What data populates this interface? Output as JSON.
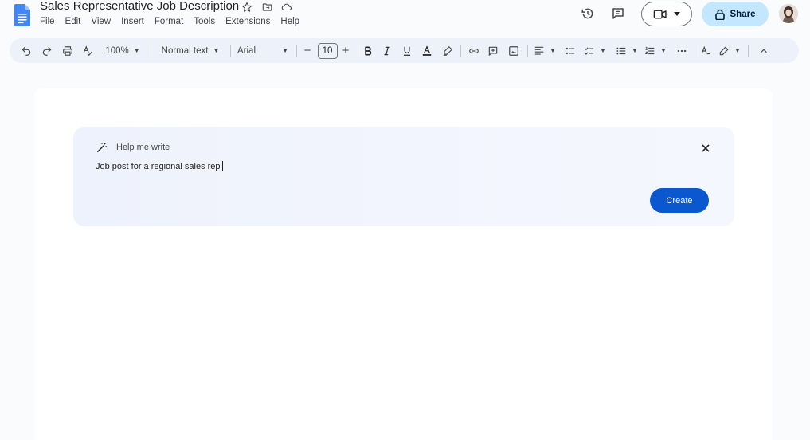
{
  "document": {
    "title": "Sales Representative Job Description"
  },
  "menu": [
    "File",
    "Edit",
    "View",
    "Insert",
    "Format",
    "Tools",
    "Extensions",
    "Help"
  ],
  "share": {
    "label": "Share"
  },
  "toolbar": {
    "zoom": "100%",
    "style": "Normal text",
    "font": "Arial",
    "font_size": "10",
    "minus": "−",
    "plus": "+"
  },
  "help_me_write": {
    "title": "Help me write",
    "input_text": "Job post for a regional sales rep",
    "create_label": "Create"
  },
  "colors": {
    "accent": "#0b57d0",
    "share_bg": "#c2e7ff",
    "toolbar_bg": "#edf2fa",
    "docs_blue": "#4285f4"
  }
}
